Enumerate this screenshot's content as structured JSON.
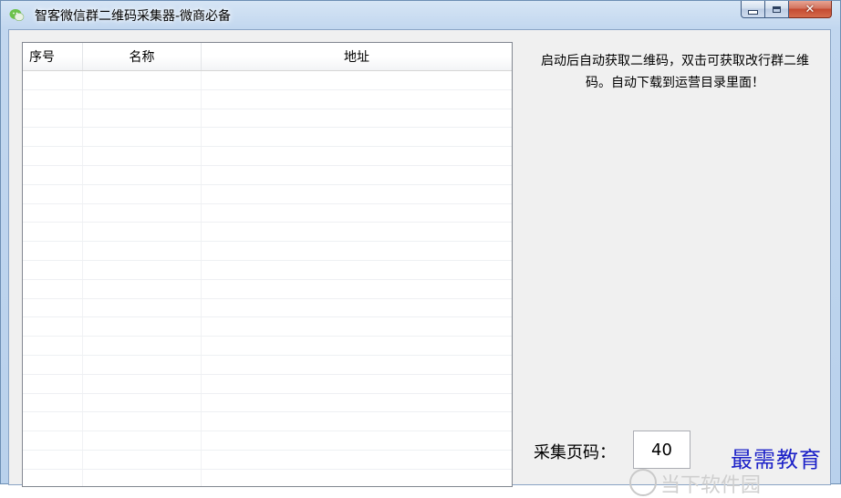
{
  "window": {
    "title": "智客微信群二维码采集器-微商必备",
    "icon": "wechat-icon"
  },
  "list": {
    "columns": [
      "序号",
      "名称",
      "地址"
    ],
    "rows": []
  },
  "info_text": "启动后自动获取二维码，双击可获取改行群二维码。自动下载到运营目录里面！",
  "page_count": {
    "label": "采集页码：",
    "value": "40"
  },
  "watermark": {
    "text": "最需教育",
    "faint_text": "当下软件园"
  },
  "colors": {
    "watermark": "#1d22c8",
    "close_button": "#c44a31"
  }
}
